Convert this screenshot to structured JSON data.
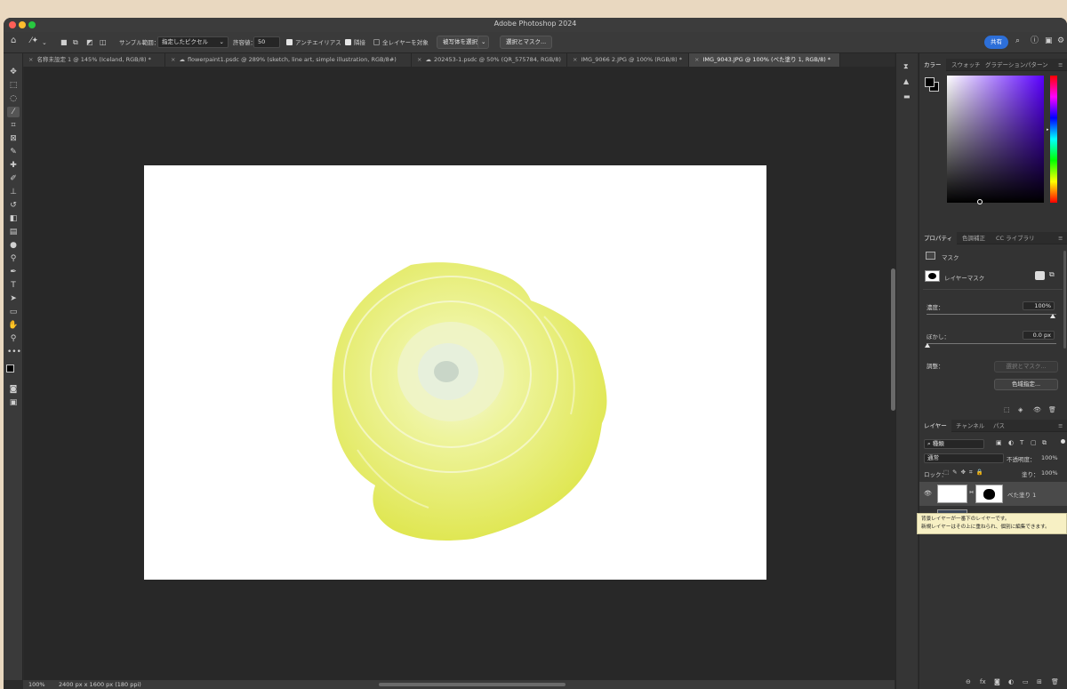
{
  "app": {
    "title": "Adobe Photoshop 2024"
  },
  "options_bar": {
    "sample_label": "サンプル範囲：",
    "sample_value": "指定したピクセル",
    "tolerance_label": "許容値：",
    "tolerance_value": "50",
    "antialias_label": "アンチエイリアス",
    "contiguous_label": "隣接",
    "all_layers_label": "全レイヤーを対象",
    "select_subject_label": "被写体を選択",
    "select_mask_label": "選択とマスク...",
    "share_label": "共有"
  },
  "tabs": [
    {
      "label": "名称未設定 1 @ 145% (Iceland, RGB/8) *"
    },
    {
      "label": "flowerpaint1.psdc @ 289% (sketch, line art, simple illustration, RGB/8#)"
    },
    {
      "label": "202453-1.psdc @ 50% (QR_575784, RGB/8)"
    },
    {
      "label": "IMG_9066 2.JPG @ 100% (RGB/8) *"
    },
    {
      "label": "IMG_9043.JPG @ 100% (べた塗り 1, RGB/8) *"
    }
  ],
  "status": {
    "zoom": "100%",
    "doc_info": "2400 px x 1600 px (180 ppi)"
  },
  "color_panel": {
    "tabs": [
      "カラー",
      "スウォッチ",
      "グラデーション",
      "パターン"
    ]
  },
  "properties_panel": {
    "tabs": [
      "プロパティ",
      "色調補正",
      "CC ライブラリ"
    ],
    "mask_label": "マスク",
    "layer_mask_label": "レイヤーマスク",
    "density_label": "濃度：",
    "density_value": "100%",
    "feather_label": "ぼかし：",
    "feather_value": "0.0 px",
    "refine_label": "調整：",
    "select_mask_button": "選択とマスク...",
    "color_range_button": "色域指定..."
  },
  "layers_panel": {
    "tabs": [
      "レイヤー",
      "チャンネル",
      "パス"
    ],
    "filter_kind": "種類",
    "blend_mode": "通常",
    "opacity_label": "不透明度：",
    "opacity_value": "100%",
    "lock_label": "ロック：",
    "fill_label": "塗り：",
    "fill_value": "100%",
    "layers": [
      {
        "name": "べた塗り 1"
      },
      {
        "name": "背景"
      }
    ],
    "tooltip_line1": "背景レイヤーが一番下のレイヤーです。",
    "tooltip_line2": "新規レイヤーはその上に重ねられ、個別に編集できます。"
  },
  "colors": {
    "accent": "#2d6fd8",
    "flower": "#e9ef7a"
  }
}
